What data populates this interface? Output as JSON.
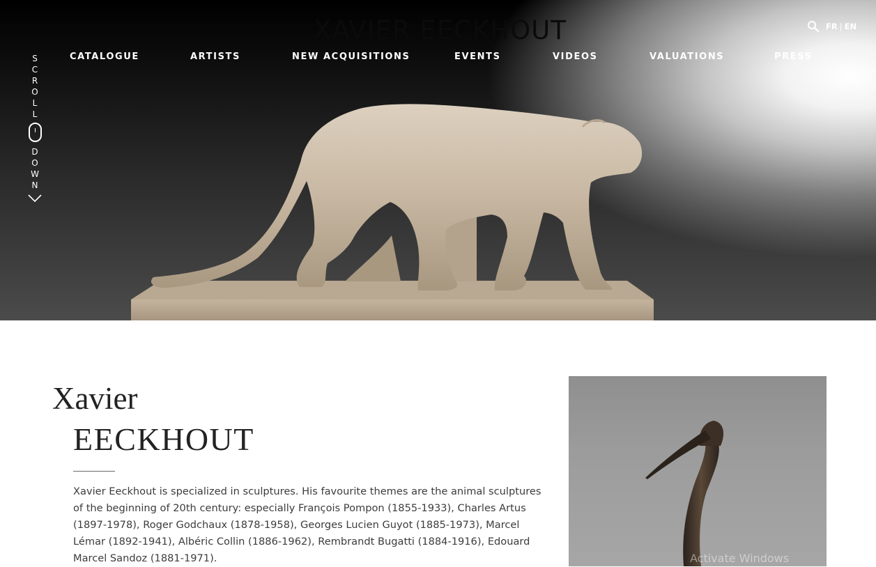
{
  "site": {
    "brand": "XAVIER EECKHOUT"
  },
  "header": {
    "nav": [
      {
        "label": "CATALOGUE"
      },
      {
        "label": "ARTISTS"
      },
      {
        "label": "NEW ACQUISITIONS"
      },
      {
        "label": "EVENTS"
      },
      {
        "label": "VIDEOS"
      },
      {
        "label": "VALUATIONS"
      },
      {
        "label": "PRESS"
      }
    ],
    "search_icon": "search-icon",
    "lang": {
      "fr": "FR",
      "separator": "|",
      "en": "EN"
    }
  },
  "scroll": {
    "top_word": "S\nC\nR\nO\nL\nL",
    "bottom_word": "D\nO\nW\nN",
    "icons": [
      "mouse-icon",
      "chevron-down-icon"
    ]
  },
  "intro": {
    "title_line1": "Xavier",
    "title_line2": "EECKHOUT",
    "bio": "Xavier Eeckhout is specialized in sculptures. His favourite themes are the animal sculptures of the beginning of 20th century: especially François Pompon (1855-1933), Charles Artus (1897-1978), Roger Godchaux (1878-1958), Georges Lucien Guyot (1885-1973), Marcel Lémar (1892-1941), Albéric Collin (1886-1962), Rembrandt Bugatti (1884-1916), Edouard Marcel Sandoz (1881-1971)."
  },
  "overlay": {
    "watermark": "Activate Windows"
  },
  "colors": {
    "nav_text": "#ffffff",
    "hero_dark": "#0e0e0e",
    "sculpture": "#cbbba6",
    "body_text": "#3c3c3c"
  }
}
